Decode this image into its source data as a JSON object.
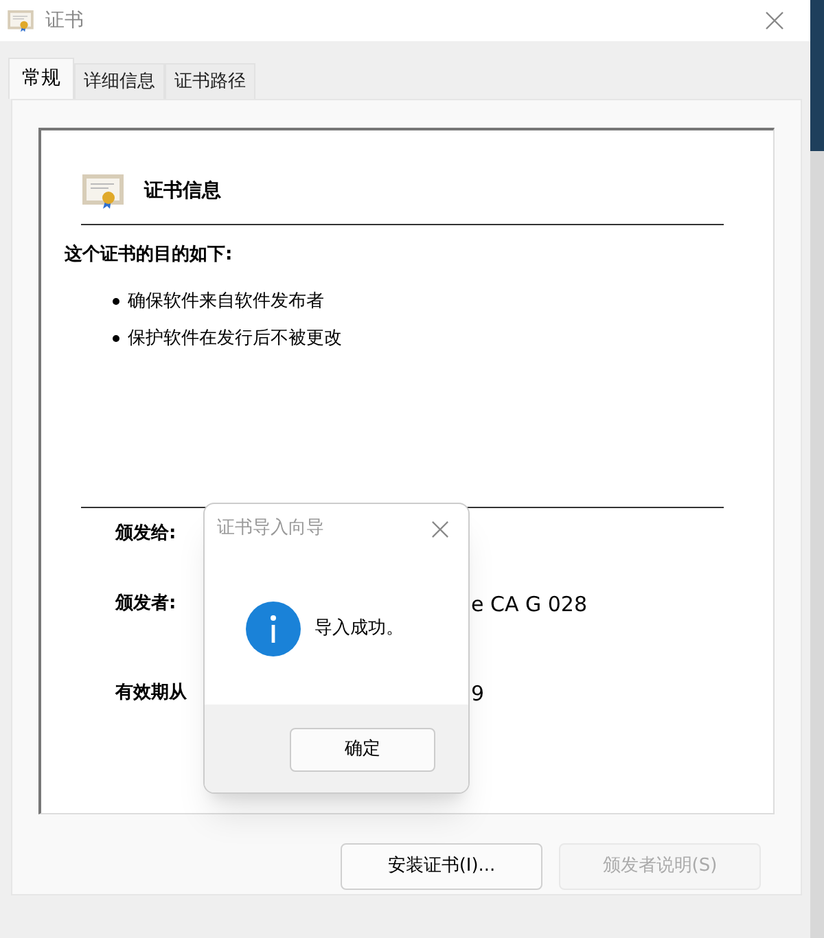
{
  "window": {
    "title": "证书"
  },
  "tabs": [
    {
      "label": "常规",
      "selected": true
    },
    {
      "label": "详细信息",
      "selected": false
    },
    {
      "label": "证书路径",
      "selected": false
    }
  ],
  "info": {
    "heading": "证书信息",
    "purpose_title": "这个证书的目的如下:",
    "purposes": [
      "确保软件来自软件发布者",
      "保护软件在发行后不被更改"
    ],
    "fields": [
      {
        "label": "颁发给:"
      },
      {
        "label": "颁发者:",
        "value": "e CA G 028"
      },
      {
        "label": "有效期从",
        "value": "9"
      }
    ]
  },
  "buttons": [
    {
      "label": "安装证书(I)...",
      "disabled": false
    },
    {
      "label": "颁发者说明(S)",
      "disabled": true
    }
  ],
  "dialog": {
    "title": "证书导入向导",
    "message": "导入成功。",
    "button": "确定"
  }
}
